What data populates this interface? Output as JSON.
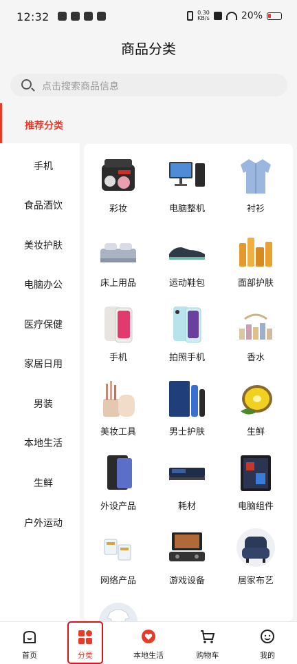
{
  "status": {
    "time": "12:32",
    "net_speed_top": "0.30",
    "net_speed_unit": "KB/s",
    "battery": "20%"
  },
  "page": {
    "title": "商品分类",
    "search_placeholder": "点击搜索商品信息"
  },
  "sidebar": {
    "selected": "推荐分类",
    "items": [
      "手机",
      "食品酒饮",
      "美妆护肤",
      "电脑办公",
      "医疗保健",
      "家居日用",
      "男装",
      "本地生活",
      "生鲜",
      "户外运动"
    ]
  },
  "grid": {
    "items": [
      {
        "label": "彩妆",
        "icon": "makeup-case-icon"
      },
      {
        "label": "电脑整机",
        "icon": "desktop-computer-icon"
      },
      {
        "label": "衬衫",
        "icon": "shirt-icon"
      },
      {
        "label": "床上用品",
        "icon": "bedding-icon"
      },
      {
        "label": "运动鞋包",
        "icon": "sneaker-icon"
      },
      {
        "label": "面部护肤",
        "icon": "skincare-bottles-icon"
      },
      {
        "label": "手机",
        "icon": "phone-icon"
      },
      {
        "label": "拍照手机",
        "icon": "camera-phone-icon"
      },
      {
        "label": "香水",
        "icon": "perfume-icon"
      },
      {
        "label": "美妆工具",
        "icon": "makeup-brushes-icon"
      },
      {
        "label": "男士护肤",
        "icon": "mens-skincare-icon"
      },
      {
        "label": "生鲜",
        "icon": "kiwi-fruit-icon"
      },
      {
        "label": "外设产品",
        "icon": "tablet-case-icon"
      },
      {
        "label": "耗材",
        "icon": "toner-cartridge-icon"
      },
      {
        "label": "电脑组件",
        "icon": "pc-case-icon"
      },
      {
        "label": "网络产品",
        "icon": "network-connector-icon"
      },
      {
        "label": "游戏设备",
        "icon": "game-console-icon"
      },
      {
        "label": "居家布艺",
        "icon": "armchair-icon"
      }
    ]
  },
  "nav": {
    "items": [
      {
        "label": "首页",
        "icon": "home-icon"
      },
      {
        "label": "分类",
        "icon": "category-icon"
      },
      {
        "label": "本地生活",
        "icon": "local-life-heart-icon"
      },
      {
        "label": "购物车",
        "icon": "cart-icon"
      },
      {
        "label": "我的",
        "icon": "profile-icon"
      }
    ],
    "active": "分类"
  },
  "colors": {
    "accent": "#e53c2a",
    "highlight_frame": "#e0101a",
    "background": "#f5f5f5"
  }
}
